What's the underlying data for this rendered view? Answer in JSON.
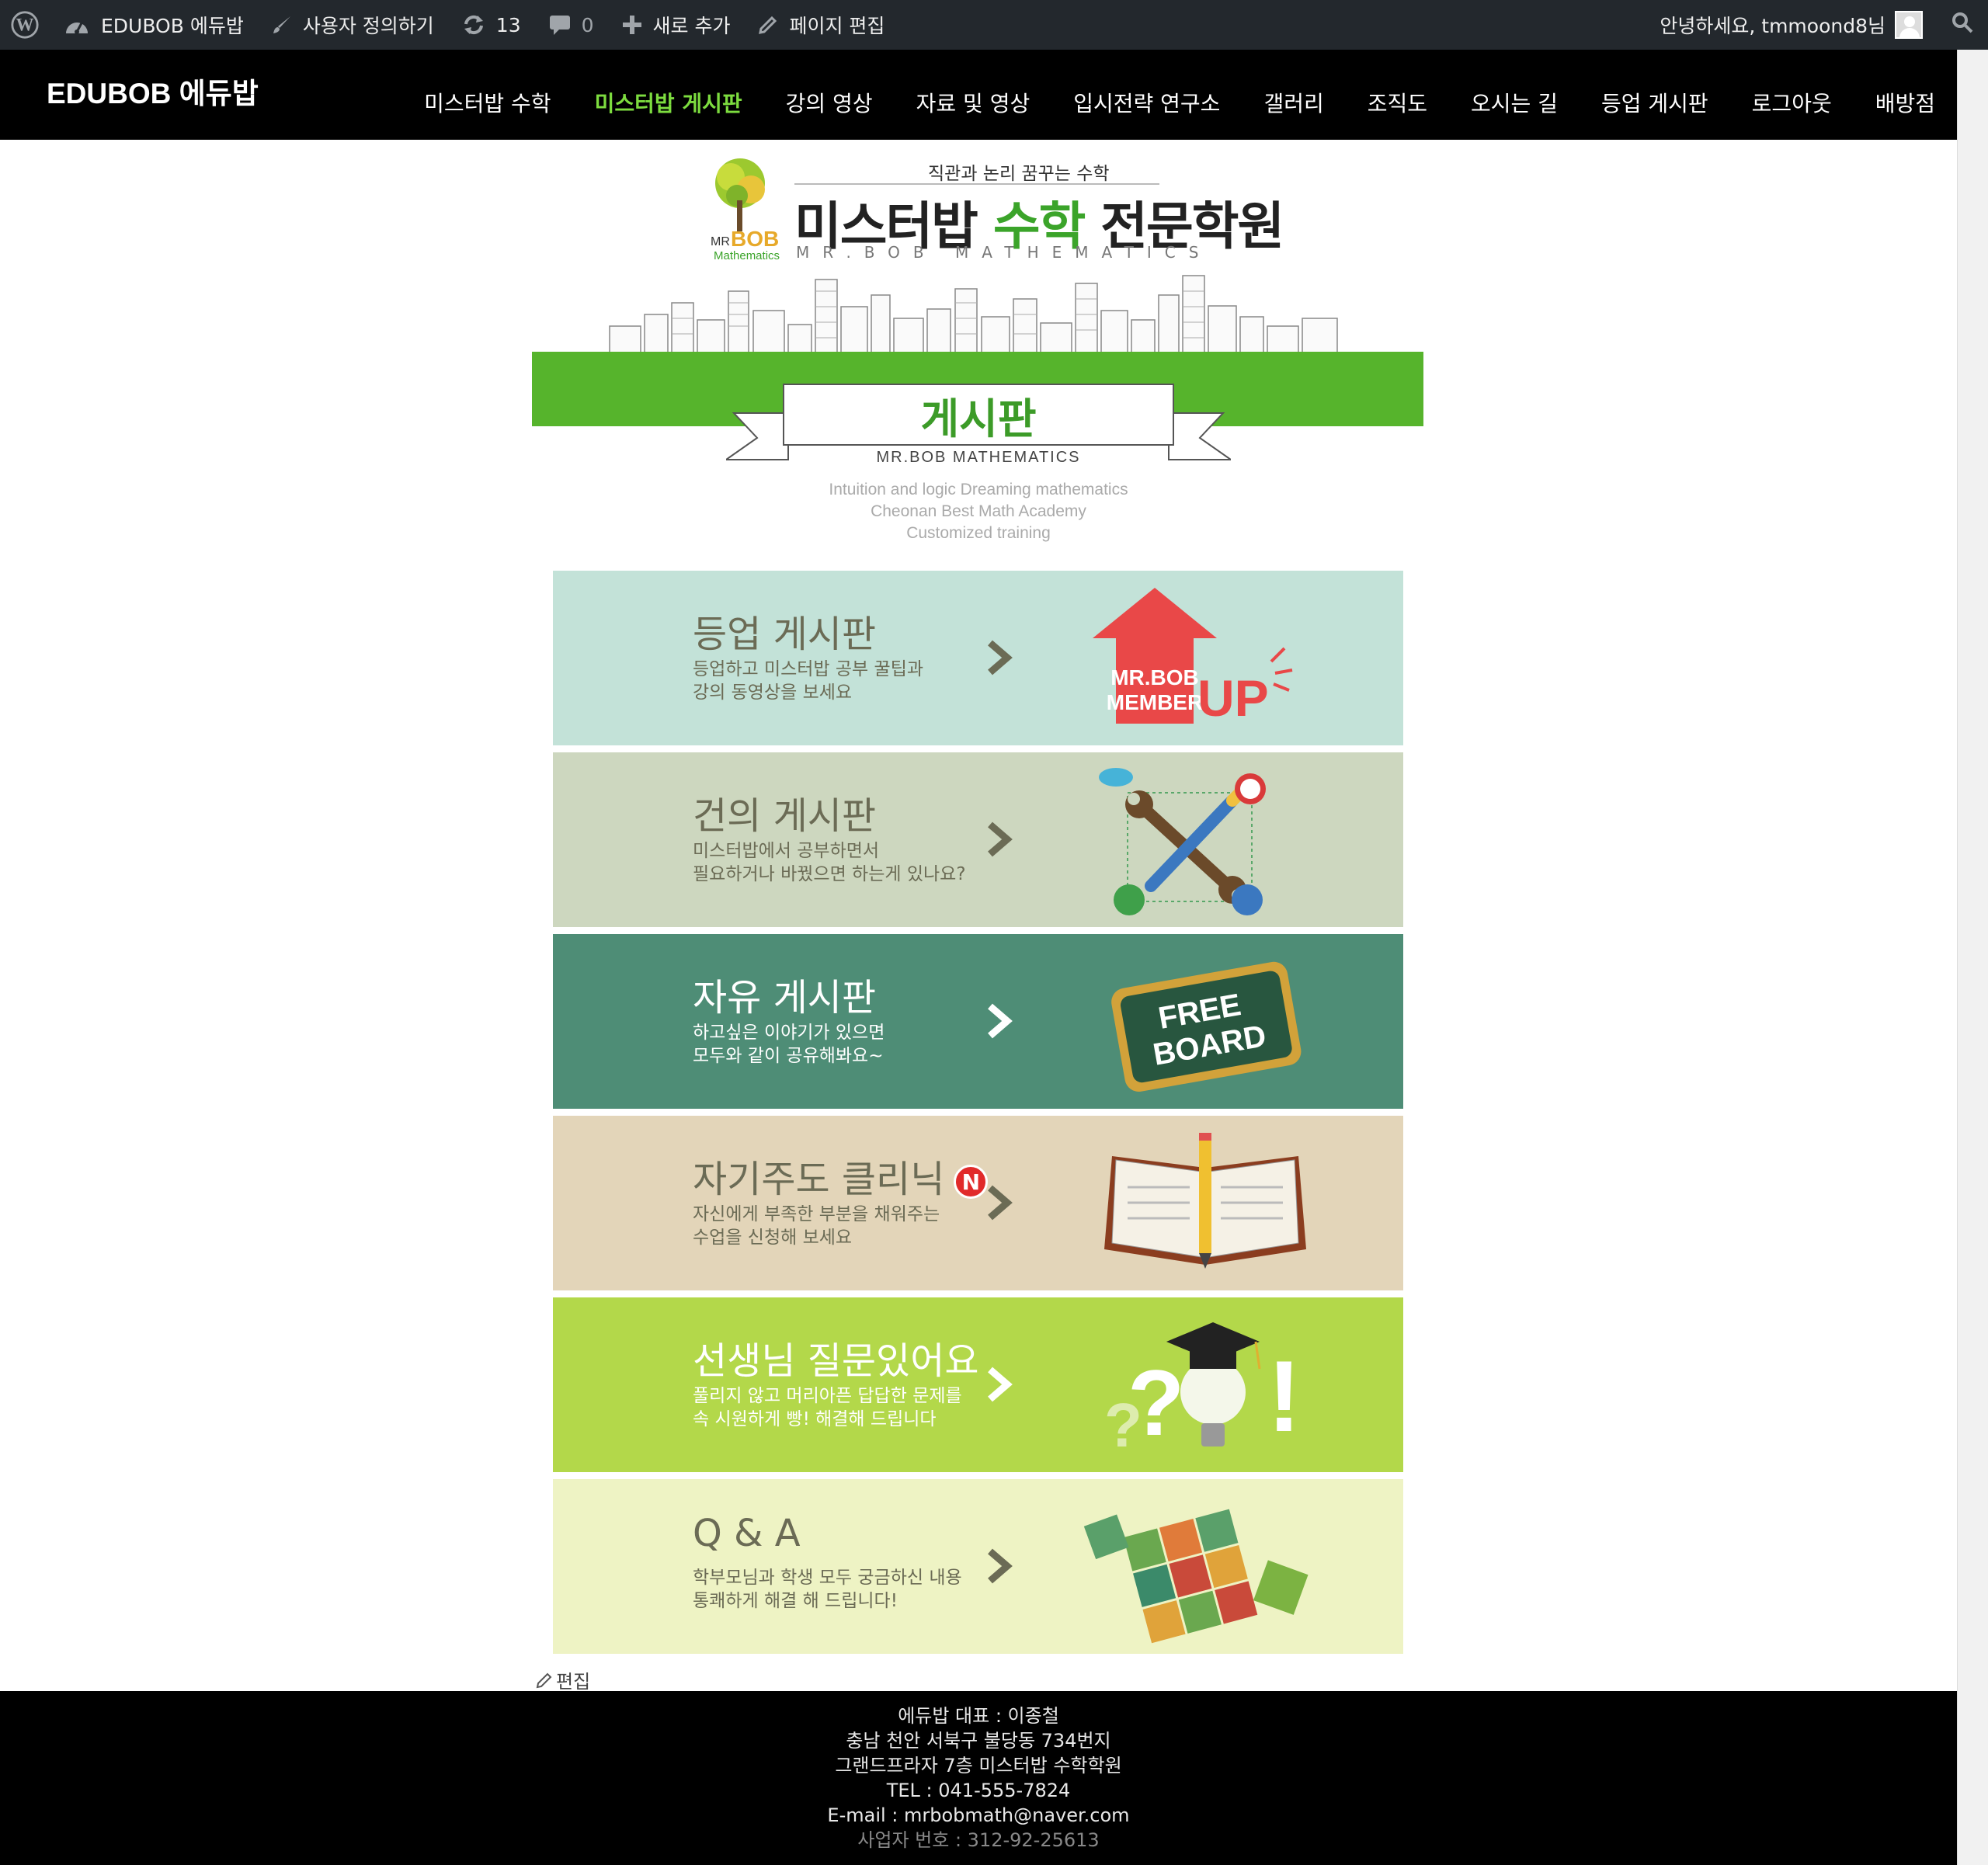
{
  "admin_bar": {
    "site_name": "EDUBOB 에듀밥",
    "customize": "사용자 정의하기",
    "updates_count": "13",
    "comments_count": "0",
    "new": "새로 추가",
    "edit_page": "페이지 편집",
    "greeting": "안녕하세요, tmmoond8님"
  },
  "site": {
    "title": "EDUBOB 에듀밥",
    "nav": [
      "미스터밥 수학",
      "미스터밥 게시판",
      "강의 영상",
      "자료 및 영상",
      "입시전략 연구소",
      "갤러리",
      "조직도",
      "오시는 길",
      "등업 게시판",
      "로그아웃",
      "배방점"
    ],
    "active_nav": "미스터밥 게시판",
    "accent": "#56b42c"
  },
  "logo": {
    "tagline": "직관과 논리 꿈꾸는 수학",
    "name_a": "미스터밥 ",
    "name_hl": "수학",
    "name_b": " 전문학원",
    "sub": "MR.BOB MATHEMATICS",
    "tree_mr": "MR",
    "tree_bob": "BOB",
    "tree_math": "Mathematics"
  },
  "banner": {
    "title": "게시판",
    "subtitle": "MR.BOB MATHEMATICS"
  },
  "intro": [
    "Intuition and logic Dreaming mathematics",
    "Cheonan Best Math Academy",
    "Customized training"
  ],
  "cards": [
    {
      "title": "등업 게시판",
      "desc1": "등업하고 미스터밥 공부 꿀팁과",
      "desc2": "강의 동영상을 보세요",
      "bg": "#c3e2d8",
      "icon": "member-up-icon",
      "art_line1": "MR.BOB",
      "art_line2": "MEMBER",
      "art_word": "UP"
    },
    {
      "title": "건의 게시판",
      "desc1": "미스터밥에서 공부하면서",
      "desc2": "필요하거나 바꿨으면 하는게 있나요?",
      "bg": "#cdd7bf",
      "icon": "tools-icon"
    },
    {
      "title": "자유 게시판",
      "desc1": "하고싶은 이야기가 있으면",
      "desc2": "모두와 같이 공유해봐요~",
      "bg": "#4e8d76",
      "icon": "free-board-icon",
      "art_line1": "FREE",
      "art_line2": "BOARD"
    },
    {
      "title": "자기주도 클리닉",
      "badge": "N",
      "desc1": "자신에게 부족한 부분을 채워주는",
      "desc2": "수업을 신청해 보세요",
      "bg": "#e3d5b9",
      "icon": "open-book-icon"
    },
    {
      "title": "선생님 질문있어요",
      "desc1": "풀리지 않고 머리아픈 답답한 문제를",
      "desc2": "속 시원하게 빵! 해결해 드립니다",
      "bg": "#b3d84a",
      "icon": "lightbulb-graduation-icon"
    },
    {
      "title": "Q & A",
      "desc1": "학부모님과 학생 모두 궁금하신 내용",
      "desc2": "통쾌하게 해결 해 드립니다!",
      "bg": "#eef3c4",
      "icon": "cubes-icon"
    }
  ],
  "edit_label": "편집",
  "footer": {
    "line1": "에듀밥 대표 : 이종철",
    "line2": "충남 천안 서북구 불당동 734번지",
    "line3": "그랜드프라자 7층 미스터밥 수학학원",
    "line4": "TEL : 041-555-7824",
    "line5": "E-mail : mrbobmath@naver.com",
    "line6": "사업자 번호 : 312-92-25613"
  }
}
